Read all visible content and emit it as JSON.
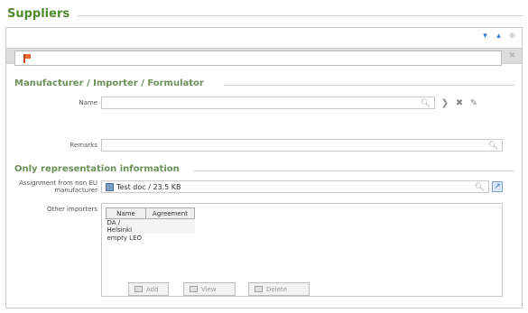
{
  "page": {
    "title": "Suppliers"
  },
  "toolbar1": {
    "icons": [
      "double-chevron-down-icon",
      "double-chevron-up-icon",
      "plus-icon"
    ]
  },
  "toolbar2": {
    "icons": [
      "double-chevron-up-icon",
      "arrow-down-icon",
      "flag-icon",
      "gear-icon",
      "delete-icon"
    ]
  },
  "manufacturer": {
    "title": "Manufacturer / Importer / Formulator",
    "name_label": "Name",
    "name_value": "",
    "remarks_label": "Remarks",
    "remarks_value": ""
  },
  "representation": {
    "title": "Only representation information",
    "assignment_label": "Assignment from non EU manufacturer",
    "assignment_value": "Test doc / 23.5 KB",
    "other_importers_label": "Other importers",
    "columns": [
      "Name",
      "Agreement"
    ],
    "rows": [
      {
        "name": "DA / Helsinki",
        "agreement": ""
      },
      {
        "name": "empty LEO",
        "agreement": ""
      }
    ]
  },
  "buttons": {
    "add": "Add",
    "view": "View",
    "delete": "Delete"
  },
  "colors": {
    "title_green": "#4f8a2e",
    "section_green": "#6c8f58",
    "toolbar_grey": "#dcdcdc",
    "icon_blue": "#2f6fcf",
    "flag_orange": "#ef6a2a"
  }
}
